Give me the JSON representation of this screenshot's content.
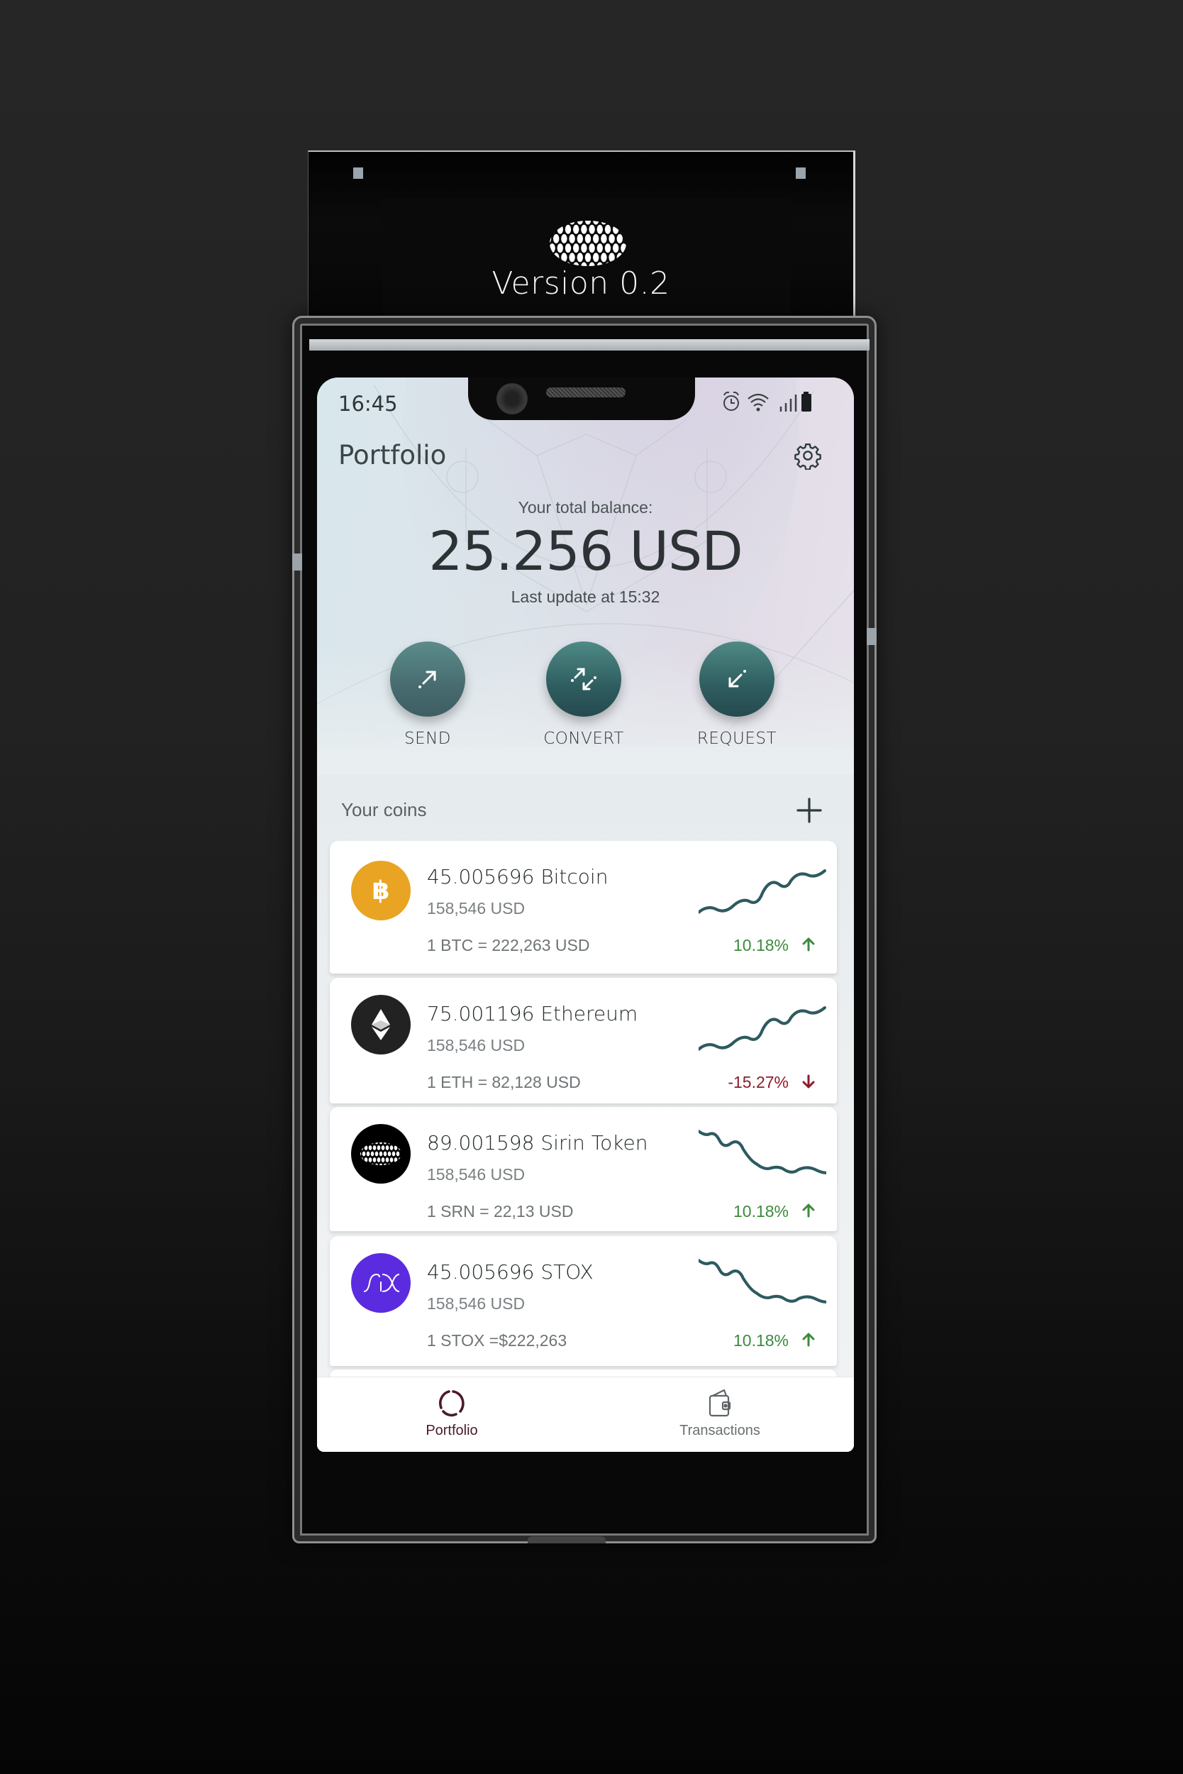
{
  "popup_display": {
    "logo_icon": "sirin-labs-logo",
    "version_text": "Version 0.2"
  },
  "status_bar": {
    "time": "16:45",
    "icons": [
      "alarm-icon",
      "wifi-icon",
      "signal-icon",
      "battery-icon"
    ]
  },
  "header": {
    "title": "Portfolio",
    "settings_icon": "gear-icon"
  },
  "balance": {
    "label": "Your total balance:",
    "amount": "25.256 USD",
    "last_update": "Last update at 15:32"
  },
  "actions": [
    {
      "label": "SEND",
      "icon": "send-arrow-icon"
    },
    {
      "label": "CONVERT",
      "icon": "convert-arrows-icon"
    },
    {
      "label": "REQUEST",
      "icon": "request-arrow-icon"
    }
  ],
  "coins_section": {
    "title": "Your coins",
    "add_icon": "plus-icon"
  },
  "coins": [
    {
      "name": "45.005696 Bitcoin",
      "usd_value": "158,546 USD",
      "rate": "1 BTC = 222,263 USD",
      "change": "10.18%",
      "direction": "up",
      "icon": "bitcoin-icon",
      "icon_color": "#E8A422",
      "trend": "rising"
    },
    {
      "name": "75.001196 Ethereum",
      "usd_value": "158,546 USD",
      "rate": "1 ETH = 82,128 USD",
      "change": "-15.27%",
      "direction": "down",
      "icon": "ethereum-icon",
      "icon_color": "#222222",
      "trend": "rising"
    },
    {
      "name": "89.001598 Sirin Token",
      "usd_value": "158,546 USD",
      "rate": "1 SRN = 22,13 USD",
      "change": "10.18%",
      "direction": "up",
      "icon": "sirin-token-icon",
      "icon_color": "#000000",
      "trend": "falling"
    },
    {
      "name": "45.005696 STOX",
      "usd_value": "158,546 USD",
      "rate": "1 STOX =$222,263",
      "change": "10.18%",
      "direction": "up",
      "icon": "stox-icon",
      "icon_color": "#5B2BE0",
      "trend": "falling"
    }
  ],
  "bottom_nav": [
    {
      "label": "Portfolio",
      "icon": "portfolio-ring-icon",
      "active": true
    },
    {
      "label": "Transactions",
      "icon": "wallet-icon",
      "active": false
    }
  ],
  "colors": {
    "accent_teal": "#2F5D5F",
    "positive": "#3C8A3C",
    "negative": "#8B1C2A",
    "nav_active": "#4A1A2C",
    "nav_inactive": "#6A6F71"
  }
}
